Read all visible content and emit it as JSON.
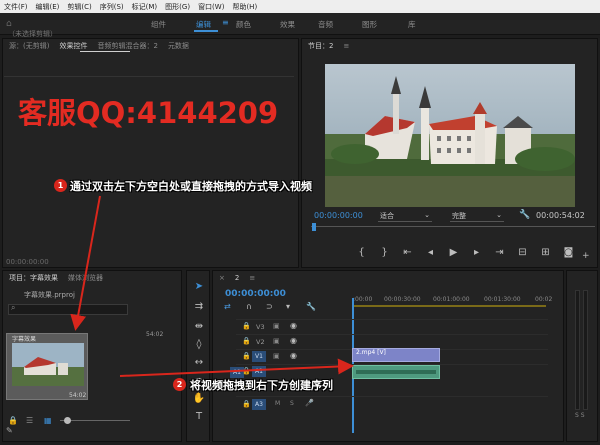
{
  "menubar": {
    "items": [
      "文件(F)",
      "编辑(E)",
      "剪辑(C)",
      "序列(S)",
      "标记(M)",
      "图形(G)",
      "窗口(W)",
      "帮助(H)"
    ]
  },
  "workspace": {
    "tabs": [
      "组件",
      "编辑",
      "颜色",
      "效果",
      "音频",
      "图形",
      "库"
    ],
    "active": "编辑"
  },
  "source_panel": {
    "tabs": [
      "源：(无剪辑)",
      "效果控件",
      "音频剪辑混合器：2",
      "元数据"
    ],
    "no_clip": "（未选择剪辑）",
    "timecode": "00:00:00:00"
  },
  "watermark": "客服QQ:4144209",
  "program_panel": {
    "title": "节目：2",
    "timecode": "00:00:00:00",
    "fit": "适合",
    "quality": "完整",
    "duration": "00:00:54:02"
  },
  "project_panel": {
    "tabs": [
      "项目：字幕效果",
      "媒体浏览器"
    ],
    "file": "字幕效果.prproj",
    "thumb_label": "字幕效果",
    "thumb_duration": "54:02",
    "thumb_bottom_duration": "54:02"
  },
  "timeline": {
    "tab": "2",
    "timecode": "00:00:00:00",
    "ruler": [
      ":00:00",
      "00:00:30:00",
      "00:01:00:00",
      "00:01:30:00",
      "00:02"
    ],
    "video_tracks": [
      "V3",
      "V2",
      "V1"
    ],
    "audio_tracks": [
      "A1",
      "A2",
      "A3"
    ],
    "clip_label": "2.mp4 [V]",
    "meter_label": "S S"
  },
  "callouts": [
    {
      "num": "1",
      "text": "通过双击左下方空白处或直接拖拽的方式导入视频"
    },
    {
      "num": "2",
      "text": "将视频拖拽到右下方创建序列"
    }
  ],
  "colors": {
    "accent": "#3d8fd6",
    "annotation_red": "#d9261c",
    "watermark_red": "#e32b22",
    "track_blue": "#2a4d78",
    "clip_purple": "#7d84c8"
  }
}
